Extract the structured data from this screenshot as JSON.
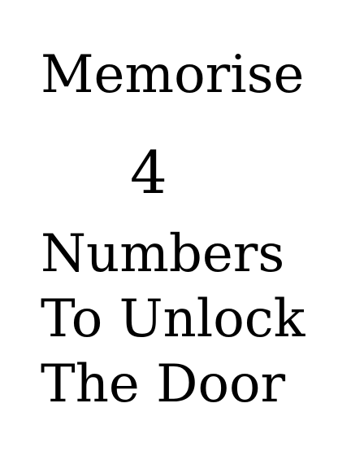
{
  "instruction": {
    "title": "Memorise",
    "count": "4",
    "line1": "Numbers",
    "line2": "To Unlock",
    "line3": "The Door"
  },
  "colors": {
    "background": "#ffffff",
    "text": "#000000"
  }
}
